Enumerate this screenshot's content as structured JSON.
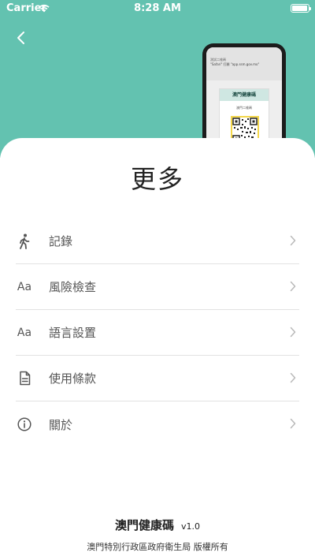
{
  "status_bar": {
    "carrier": "Carrier",
    "time": "8:28 AM"
  },
  "hero": {
    "background_color": "#63c2b0",
    "phone_preview": {
      "url_line": "測試二維碼",
      "url_sub": "\"Safari\" 打開 \"app.ssm.gov.mo\"",
      "card_title": "澳門健康碼",
      "card_sub": "澳門二維碼"
    }
  },
  "page": {
    "title": "更多"
  },
  "menu": {
    "items": [
      {
        "label": "記錄",
        "icon": "walking-person-icon"
      },
      {
        "label": "風險檢查",
        "icon": "text-aa-icon",
        "icon_text": "Aa"
      },
      {
        "label": "語言設置",
        "icon": "text-aa-icon",
        "icon_text": "Aa"
      },
      {
        "label": "使用條款",
        "icon": "document-icon"
      },
      {
        "label": "關於",
        "icon": "info-icon"
      }
    ]
  },
  "footer": {
    "app_name": "澳門健康碼",
    "version": "v1.0",
    "copyright": "澳門特別行政區政府衛生局 版權所有"
  }
}
